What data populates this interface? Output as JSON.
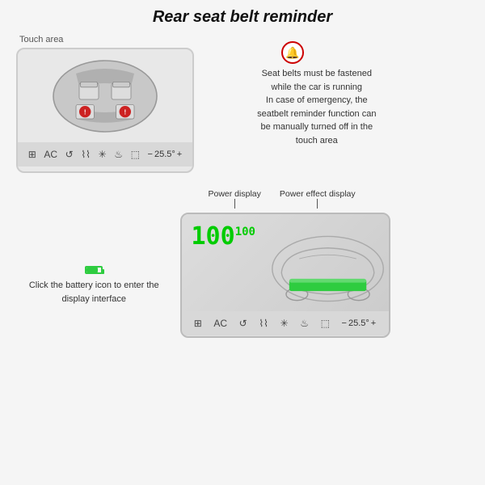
{
  "title": "Rear seat belt reminder",
  "top_section": {
    "touch_area_label": "Touch area",
    "annotation": "Seat belts must be fastened\nwhile the car is running\nIn case of emergency, the\nseatbelt reminder function can\nbe manually turned off in the\ntouch area",
    "toolbar": {
      "temp": "25.5°",
      "plus": "+",
      "minus": "−"
    }
  },
  "bottom_section": {
    "click_text": "Click the battery icon to enter the\ndisplay interface",
    "power_display_label": "Power display",
    "power_effect_label": "Power effect display",
    "battery_percent": "100",
    "toolbar": {
      "temp": "25.5°",
      "plus": "+",
      "minus": "−"
    }
  }
}
